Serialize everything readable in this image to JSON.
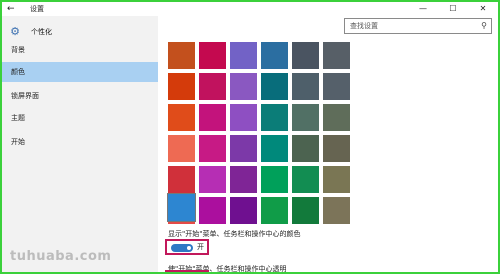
{
  "titlebar": {
    "back_symbol": "←",
    "title": "设置",
    "minimize_symbol": "—",
    "maximize_symbol": "☐",
    "close_symbol": "✕"
  },
  "sidebar": {
    "header_icon": "gear-icon",
    "header_title": "个性化",
    "items": [
      {
        "label": "背景"
      },
      {
        "label": "颜色"
      },
      {
        "label": "锁屏界面"
      },
      {
        "label": "主题"
      },
      {
        "label": "开始"
      }
    ],
    "active_item": "颜色"
  },
  "search": {
    "placeholder": "查找设置",
    "icon": "search-icon"
  },
  "colors": {
    "rows": [
      [
        "#c3501d",
        "#c4094f",
        "#7262c6",
        "#2b6ea1",
        "#4a5461",
        "#575f67"
      ],
      [
        "#d43b0b",
        "#c1125e",
        "#8a58c1",
        "#086d7b",
        "#4e5f6a",
        "#55606a"
      ],
      [
        "#e04c1a",
        "#c3137c",
        "#8e4fc2",
        "#0b7d78",
        "#517065",
        "#5f6d5a"
      ],
      [
        "#ee6a53",
        "#c71a85",
        "#7c39a8",
        "#00897b",
        "#4c6350",
        "#666451"
      ],
      [
        "#d0303a",
        "#b62eb4",
        "#7f2596",
        "#00a05a",
        "#128d52",
        "#7a7654"
      ],
      [
        "#e54a47",
        "#ab0f9e",
        "#6f1090",
        "#109c48",
        "#127a3b",
        "#7c7459"
      ]
    ],
    "selected": "#2d86d1"
  },
  "accent_setting": {
    "label": "显示\"开始\"菜单、任务栏和操作中心的颜色",
    "state": "开",
    "on": true,
    "accent_color": "#2f78c5"
  },
  "transparency_setting": {
    "label": "使\"开始\"菜单、任务栏和操作中心透明"
  },
  "watermark": {
    "text": "tuhuaba.com"
  }
}
